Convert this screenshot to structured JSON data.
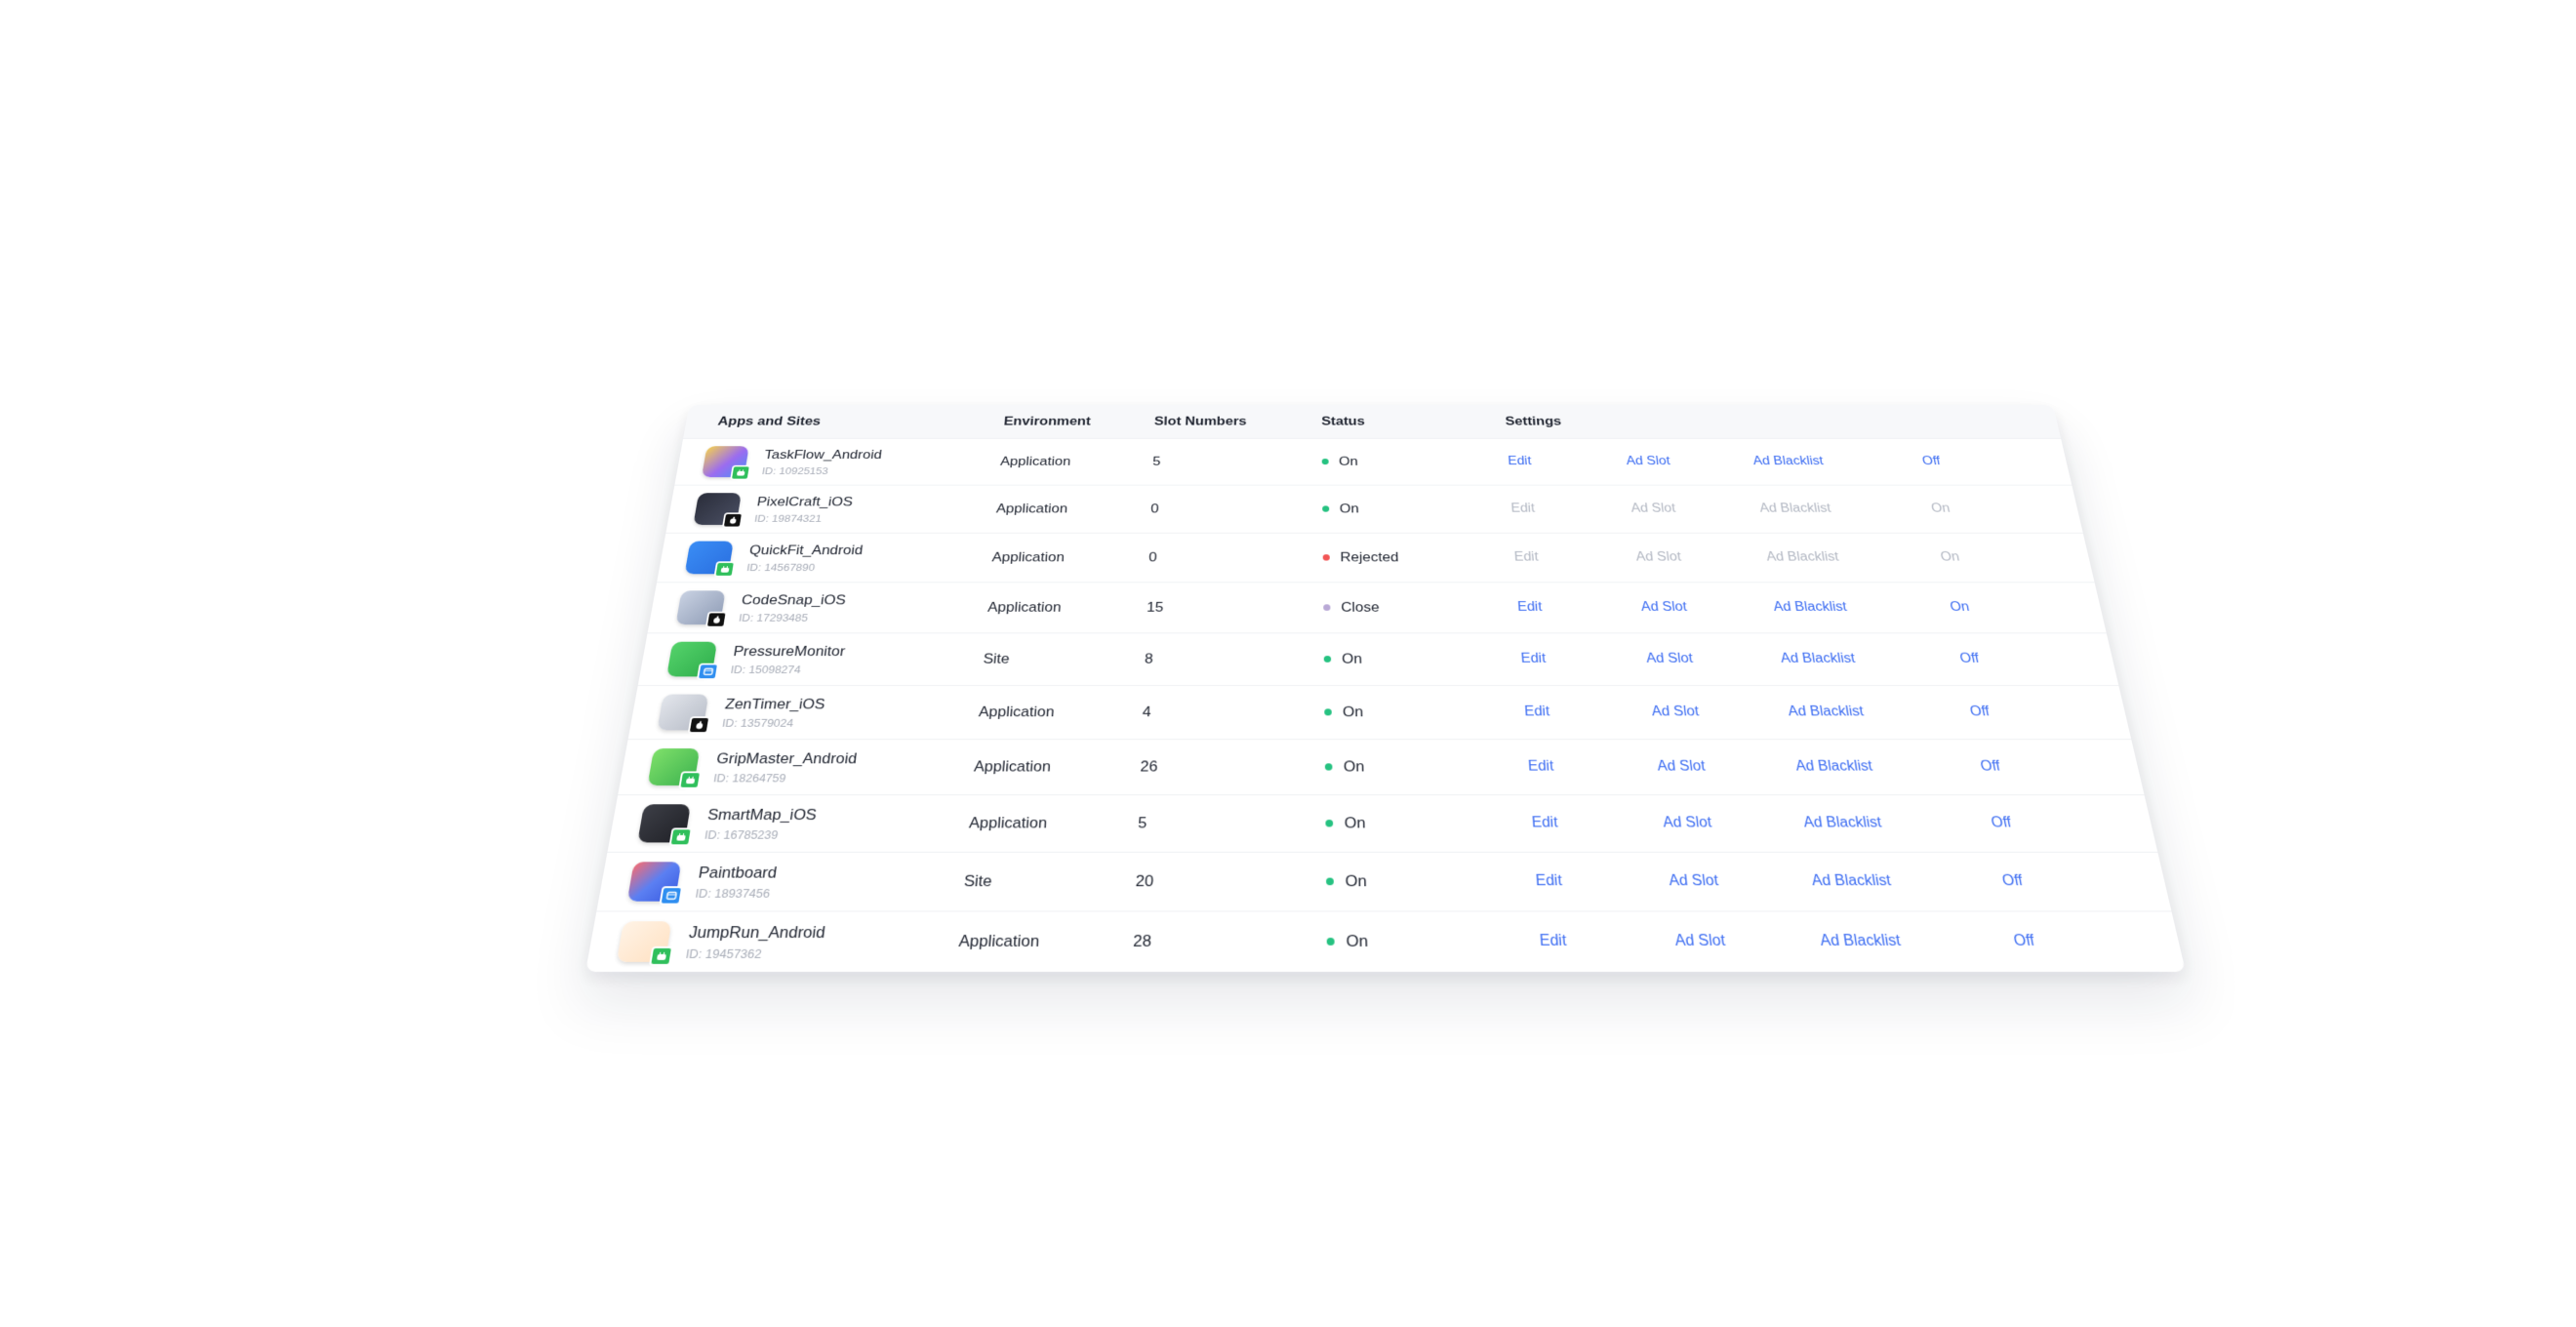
{
  "columns": {
    "app": "Apps and Sites",
    "environment": "Environment",
    "slots": "Slot Numbers",
    "status": "Status",
    "settings": "Settings"
  },
  "colors": {
    "status_on": "#26c281",
    "status_rejected": "#f25555",
    "status_close": "#b9a9d6",
    "link": "#3d6df2",
    "link_disabled": "#b3b8c3"
  },
  "rows": [
    {
      "name": "TaskFlow_Android",
      "id": "ID: 10925153",
      "platform": "android",
      "icon": "taskflow-icon",
      "env": "Application",
      "slots": "5",
      "status": "On",
      "status_kind": "on",
      "edit": "Edit",
      "ad_slot": "Ad Slot",
      "ad_blacklist": "Ad Blacklist",
      "toggle": "Off",
      "disabled": false
    },
    {
      "name": "PixelCraft_iOS",
      "id": "ID: 19874321",
      "platform": "ios",
      "icon": "pixelcraft-icon",
      "env": "Application",
      "slots": "0",
      "status": "On",
      "status_kind": "on",
      "edit": "Edit",
      "ad_slot": "Ad Slot",
      "ad_blacklist": "Ad Blacklist",
      "toggle": "On",
      "disabled": true
    },
    {
      "name": "QuickFit_Android",
      "id": "ID: 14567890",
      "platform": "android",
      "icon": "quickfit-icon",
      "env": "Application",
      "slots": "0",
      "status": "Rejected",
      "status_kind": "rejected",
      "edit": "Edit",
      "ad_slot": "Ad Slot",
      "ad_blacklist": "Ad Blacklist",
      "toggle": "On",
      "disabled": true
    },
    {
      "name": "CodeSnap_iOS",
      "id": "ID: 17293485",
      "platform": "ios",
      "icon": "codesnap-icon",
      "env": "Application",
      "slots": "15",
      "status": "Close",
      "status_kind": "close",
      "edit": "Edit",
      "ad_slot": "Ad Slot",
      "ad_blacklist": "Ad Blacklist",
      "toggle": "On",
      "disabled": false
    },
    {
      "name": "PressureMonitor",
      "id": "ID: 15098274",
      "platform": "web",
      "icon": "pressure-monitor-icon",
      "env": "Site",
      "slots": "8",
      "status": "On",
      "status_kind": "on",
      "edit": "Edit",
      "ad_slot": "Ad Slot",
      "ad_blacklist": "Ad Blacklist",
      "toggle": "Off",
      "disabled": false
    },
    {
      "name": "ZenTimer_iOS",
      "id": "ID: 13579024",
      "platform": "ios",
      "icon": "zentimer-icon",
      "env": "Application",
      "slots": "4",
      "status": "On",
      "status_kind": "on",
      "edit": "Edit",
      "ad_slot": "Ad Slot",
      "ad_blacklist": "Ad Blacklist",
      "toggle": "Off",
      "disabled": false
    },
    {
      "name": "GripMaster_Android",
      "id": "ID: 18264759",
      "platform": "android",
      "icon": "gripmaster-icon",
      "env": "Application",
      "slots": "26",
      "status": "On",
      "status_kind": "on",
      "edit": "Edit",
      "ad_slot": "Ad Slot",
      "ad_blacklist": "Ad Blacklist",
      "toggle": "Off",
      "disabled": false
    },
    {
      "name": "SmartMap_iOS",
      "id": "ID: 16785239",
      "platform": "android",
      "icon": "smartmap-icon",
      "env": "Application",
      "slots": "5",
      "status": "On",
      "status_kind": "on",
      "edit": "Edit",
      "ad_slot": "Ad Slot",
      "ad_blacklist": "Ad Blacklist",
      "toggle": "Off",
      "disabled": false
    },
    {
      "name": "Paintboard",
      "id": "ID: 18937456",
      "platform": "web",
      "icon": "paintboard-icon",
      "env": "Site",
      "slots": "20",
      "status": "On",
      "status_kind": "on",
      "edit": "Edit",
      "ad_slot": "Ad Slot",
      "ad_blacklist": "Ad Blacklist",
      "toggle": "Off",
      "disabled": false
    },
    {
      "name": "JumpRun_Android",
      "id": "ID: 19457362",
      "platform": "android",
      "icon": "jumprun-icon",
      "env": "Application",
      "slots": "28",
      "status": "On",
      "status_kind": "on",
      "edit": "Edit",
      "ad_slot": "Ad Slot",
      "ad_blacklist": "Ad Blacklist",
      "toggle": "Off",
      "disabled": false
    }
  ]
}
